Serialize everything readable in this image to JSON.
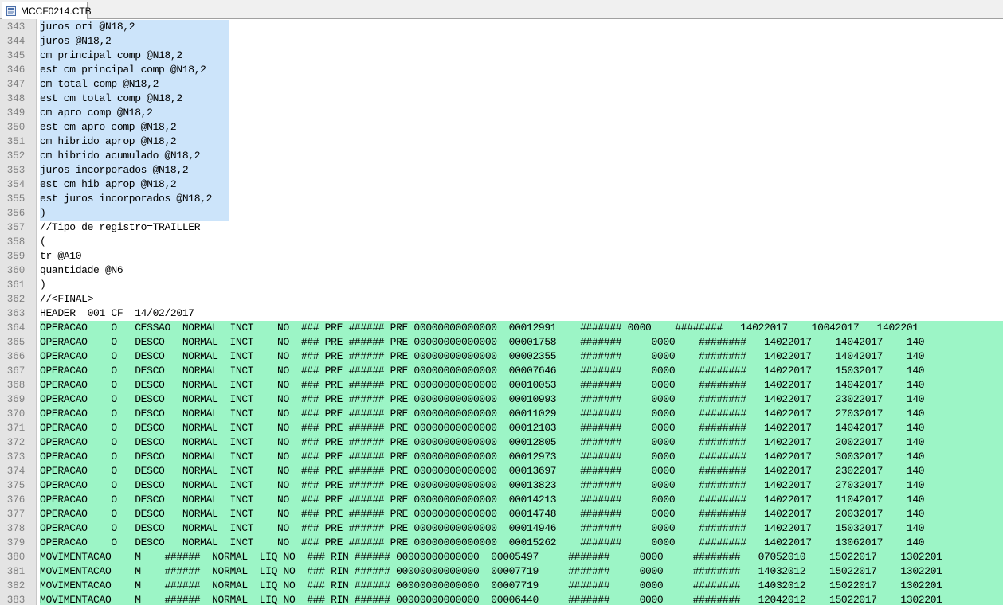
{
  "tab": {
    "title": "MCCF0214.CTB",
    "icon": "notepad-document-icon"
  },
  "colors": {
    "selection": "#cce4fa",
    "mark_green": "#9cf5c6",
    "gutter": "#e4e4e4"
  },
  "lines": [
    {
      "n": "343",
      "text": "juros ori @N18,2",
      "hl": "sel"
    },
    {
      "n": "344",
      "text": "juros @N18,2",
      "hl": "sel"
    },
    {
      "n": "345",
      "text": "cm principal comp @N18,2",
      "hl": "sel"
    },
    {
      "n": "346",
      "text": "est cm principal comp @N18,2",
      "hl": "sel"
    },
    {
      "n": "347",
      "text": "cm total comp @N18,2",
      "hl": "sel"
    },
    {
      "n": "348",
      "text": "est cm total comp @N18,2",
      "hl": "sel"
    },
    {
      "n": "349",
      "text": "cm apro comp @N18,2",
      "hl": "sel"
    },
    {
      "n": "350",
      "text": "est cm apro comp @N18,2",
      "hl": "sel"
    },
    {
      "n": "351",
      "text": "cm hibrido aprop @N18,2",
      "hl": "sel"
    },
    {
      "n": "352",
      "text": "cm hibrido acumulado @N18,2",
      "hl": "sel"
    },
    {
      "n": "353",
      "text": "juros_incorporados @N18,2",
      "hl": "sel"
    },
    {
      "n": "354",
      "text": "est cm hib aprop @N18,2",
      "hl": "sel"
    },
    {
      "n": "355",
      "text": "est juros incorporados @N18,2",
      "hl": "sel"
    },
    {
      "n": "356",
      "text": ")",
      "hl": "sel"
    },
    {
      "n": "357",
      "text": "//Tipo de registro=TRAILLER",
      "hl": ""
    },
    {
      "n": "358",
      "text": "(",
      "hl": ""
    },
    {
      "n": "359",
      "text": "tr @A10",
      "hl": ""
    },
    {
      "n": "360",
      "text": "quantidade @N6",
      "hl": ""
    },
    {
      "n": "361",
      "text": ")",
      "hl": ""
    },
    {
      "n": "362",
      "text": "//<FINAL>",
      "hl": ""
    },
    {
      "n": "363",
      "text": "HEADER  001 CF  14/02/2017",
      "hl": ""
    },
    {
      "n": "364",
      "text": "OPERACAO    O   CESSAO  NORMAL  INCT    NO  ### PRE ###### PRE 00000000000000  00012991    ####### 0000    ########   14022017    10042017   1402201",
      "hl": "green"
    },
    {
      "n": "365",
      "text": "OPERACAO    O   DESCO   NORMAL  INCT    NO  ### PRE ###### PRE 00000000000000  00001758    #######     0000    ########   14022017    14042017    140",
      "hl": "green"
    },
    {
      "n": "366",
      "text": "OPERACAO    O   DESCO   NORMAL  INCT    NO  ### PRE ###### PRE 00000000000000  00002355    #######     0000    ########   14022017    14042017    140",
      "hl": "green"
    },
    {
      "n": "367",
      "text": "OPERACAO    O   DESCO   NORMAL  INCT    NO  ### PRE ###### PRE 00000000000000  00007646    #######     0000    ########   14022017    15032017    140",
      "hl": "green"
    },
    {
      "n": "368",
      "text": "OPERACAO    O   DESCO   NORMAL  INCT    NO  ### PRE ###### PRE 00000000000000  00010053    #######     0000    ########   14022017    14042017    140",
      "hl": "green"
    },
    {
      "n": "369",
      "text": "OPERACAO    O   DESCO   NORMAL  INCT    NO  ### PRE ###### PRE 00000000000000  00010993    #######     0000    ########   14022017    23022017    140",
      "hl": "green"
    },
    {
      "n": "370",
      "text": "OPERACAO    O   DESCO   NORMAL  INCT    NO  ### PRE ###### PRE 00000000000000  00011029    #######     0000    ########   14022017    27032017    140",
      "hl": "green"
    },
    {
      "n": "371",
      "text": "OPERACAO    O   DESCO   NORMAL  INCT    NO  ### PRE ###### PRE 00000000000000  00012103    #######     0000    ########   14022017    14042017    140",
      "hl": "green"
    },
    {
      "n": "372",
      "text": "OPERACAO    O   DESCO   NORMAL  INCT    NO  ### PRE ###### PRE 00000000000000  00012805    #######     0000    ########   14022017    20022017    140",
      "hl": "green"
    },
    {
      "n": "373",
      "text": "OPERACAO    O   DESCO   NORMAL  INCT    NO  ### PRE ###### PRE 00000000000000  00012973    #######     0000    ########   14022017    30032017    140",
      "hl": "green"
    },
    {
      "n": "374",
      "text": "OPERACAO    O   DESCO   NORMAL  INCT    NO  ### PRE ###### PRE 00000000000000  00013697    #######     0000    ########   14022017    23022017    140",
      "hl": "green"
    },
    {
      "n": "375",
      "text": "OPERACAO    O   DESCO   NORMAL  INCT    NO  ### PRE ###### PRE 00000000000000  00013823    #######     0000    ########   14022017    27032017    140",
      "hl": "green"
    },
    {
      "n": "376",
      "text": "OPERACAO    O   DESCO   NORMAL  INCT    NO  ### PRE ###### PRE 00000000000000  00014213    #######     0000    ########   14022017    11042017    140",
      "hl": "green"
    },
    {
      "n": "377",
      "text": "OPERACAO    O   DESCO   NORMAL  INCT    NO  ### PRE ###### PRE 00000000000000  00014748    #######     0000    ########   14022017    20032017    140",
      "hl": "green"
    },
    {
      "n": "378",
      "text": "OPERACAO    O   DESCO   NORMAL  INCT    NO  ### PRE ###### PRE 00000000000000  00014946    #######     0000    ########   14022017    15032017    140",
      "hl": "green"
    },
    {
      "n": "379",
      "text": "OPERACAO    O   DESCO   NORMAL  INCT    NO  ### PRE ###### PRE 00000000000000  00015262    #######     0000    ########   14022017    13062017    140",
      "hl": "green"
    },
    {
      "n": "380",
      "text": "MOVIMENTACAO    M    ######  NORMAL  LIQ NO  ### RIN ###### 00000000000000  00005497     #######     0000     ########   07052010    15022017    1302201",
      "hl": "green"
    },
    {
      "n": "381",
      "text": "MOVIMENTACAO    M    ######  NORMAL  LIQ NO  ### RIN ###### 00000000000000  00007719     #######     0000     ########   14032012    15022017    1302201",
      "hl": "green"
    },
    {
      "n": "382",
      "text": "MOVIMENTACAO    M    ######  NORMAL  LIQ NO  ### RIN ###### 00000000000000  00007719     #######     0000     ########   14032012    15022017    1302201",
      "hl": "green"
    },
    {
      "n": "383",
      "text": "MOVIMENTACAO    M    ######  NORMAL  LIQ NO  ### RIN ###### 00000000000000  00006440     #######     0000     ########   12042012    15022017    1302201",
      "hl": "green"
    }
  ]
}
